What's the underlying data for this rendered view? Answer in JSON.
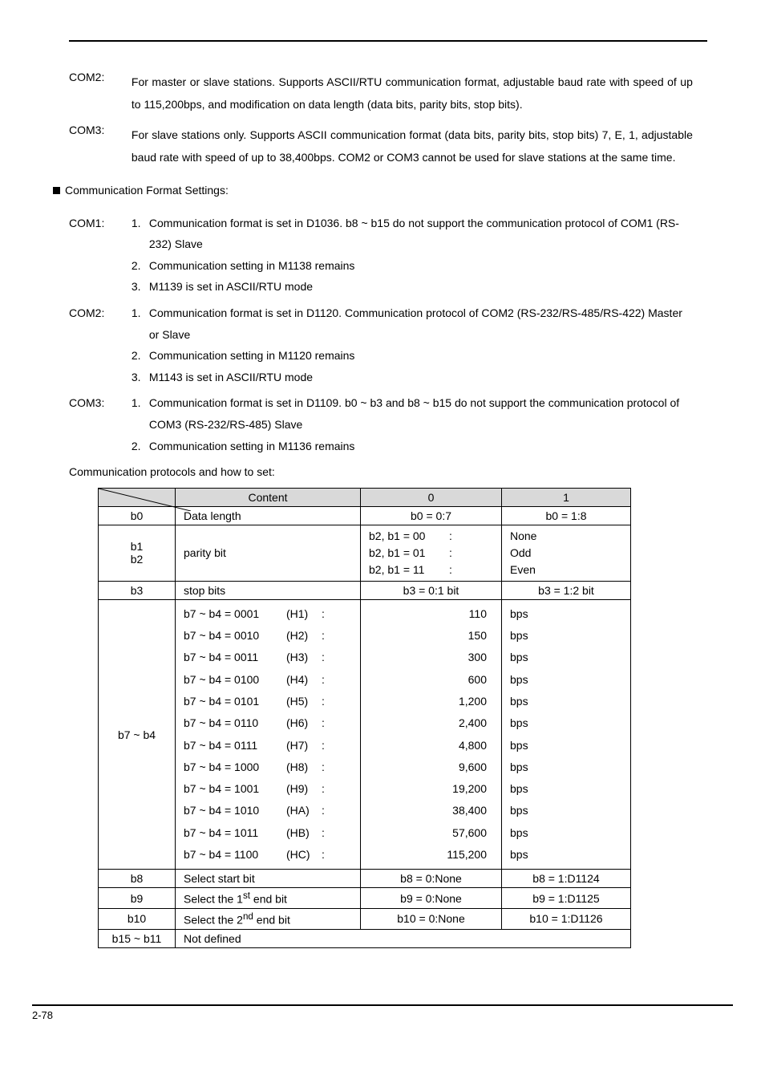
{
  "intro": {
    "com2": {
      "label": "COM2:",
      "text": "For master or slave stations. Supports ASCII/RTU communication format, adjustable baud rate with speed of up to 115,200bps, and modification on data length (data bits, parity bits, stop bits)."
    },
    "com3": {
      "label": "COM3:",
      "text": "For slave stations only. Supports ASCII communication format (data bits, parity bits, stop bits) 7, E, 1, adjustable baud rate with speed of up to 38,400bps. COM2 or COM3 cannot be used for slave stations at the same time."
    }
  },
  "section_heading": "Communication Format Settings:",
  "settings": {
    "com1": {
      "label": "COM1:",
      "items": [
        "Communication format is set in D1036. b8 ~ b15 do not support the communication protocol of COM1 (RS-232) Slave",
        "Communication setting in M1138 remains",
        "M1139 is set in ASCII/RTU mode"
      ]
    },
    "com2": {
      "label": "COM2:",
      "items": [
        "Communication format is set in D1120. Communication protocol of COM2 (RS-232/RS-485/RS-422) Master or Slave",
        "Communication setting in M1120 remains",
        "M1143 is set in ASCII/RTU mode"
      ]
    },
    "com3": {
      "label": "COM3:",
      "items": [
        "Communication format is set in D1109. b0 ~ b3 and b8 ~ b15 do not support the communication protocol of COM3 (RS-232/RS-485) Slave",
        "Communication setting in M1136 remains"
      ]
    }
  },
  "numbers": [
    "1.",
    "2.",
    "3."
  ],
  "table_caption": "Communication protocols and how to set:",
  "table": {
    "headers": {
      "content": "Content",
      "zero": "0",
      "one": "1"
    },
    "b0": {
      "row": "b0",
      "label": "Data length",
      "zero": "b0 = 0:7",
      "one": "b0 = 1:8"
    },
    "b12": {
      "row": "b1\nb2",
      "label": "parity bit",
      "zero": [
        {
          "l": "b2, b1 = 00",
          "c": ":"
        },
        {
          "l": "b2, b1 = 01",
          "c": ":"
        },
        {
          "l": "b2, b1 = 11",
          "c": ":"
        }
      ],
      "one": [
        "None",
        "Odd",
        "Even"
      ]
    },
    "b3": {
      "row": "b3",
      "label": "stop bits",
      "zero": "b3 = 0:1 bit",
      "one": "b3 = 1:2 bit"
    },
    "baud": {
      "row": "b7 ~ b4",
      "lines": [
        {
          "a": "b7 ~ b4 = 0001",
          "b": "(H1)",
          "c": ":"
        },
        {
          "a": "b7 ~ b4 = 0010",
          "b": "(H2)",
          "c": ":"
        },
        {
          "a": "b7 ~ b4 = 0011",
          "b": "(H3)",
          "c": ":"
        },
        {
          "a": "b7 ~ b4 = 0100",
          "b": "(H4)",
          "c": ":"
        },
        {
          "a": "b7 ~ b4 = 0101",
          "b": "(H5)",
          "c": ":"
        },
        {
          "a": "b7 ~ b4 = 0110",
          "b": "(H6)",
          "c": ":"
        },
        {
          "a": "b7 ~ b4 = 0111",
          "b": "(H7)",
          "c": ":"
        },
        {
          "a": "b7 ~ b4 = 1000",
          "b": "(H8)",
          "c": ":"
        },
        {
          "a": "b7 ~ b4 = 1001",
          "b": "(H9)",
          "c": ":"
        },
        {
          "a": "b7 ~ b4 = 1010",
          "b": "(HA)",
          "c": ":"
        },
        {
          "a": "b7 ~ b4 = 1011",
          "b": "(HB)",
          "c": ":"
        },
        {
          "a": "b7 ~ b4 = 1100",
          "b": "(HC)",
          "c": ":"
        }
      ],
      "zero": [
        "110",
        "150",
        "300",
        "600",
        "1,200",
        "2,400",
        "4,800",
        "9,600",
        "19,200",
        "38,400",
        "57,600",
        "115,200"
      ],
      "one_unit": "bps"
    },
    "b8": {
      "row": "b8",
      "label": "Select start bit",
      "zero": "b8 = 0:None",
      "one": "b8 = 1:D1124"
    },
    "b9": {
      "row": "b9",
      "label_pre": "Select the 1",
      "label_sup": "st",
      "label_post": " end bit",
      "zero": "b9 = 0:None",
      "one": "b9 = 1:D1125"
    },
    "b10": {
      "row": "b10",
      "label_pre": "Select the 2",
      "label_sup": "nd",
      "label_post": " end bit",
      "zero": "b10 = 0:None",
      "one": "b10 = 1:D1126"
    },
    "b1511": {
      "row": "b15 ~ b11",
      "label": "Not defined"
    }
  },
  "footer": "2-78"
}
